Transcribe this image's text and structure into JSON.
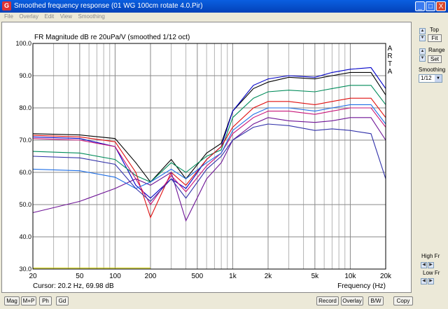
{
  "window": {
    "title": "Smoothed frequency response (01 WG 100cm rotate 4.0.Pir)",
    "icon": "arta-app-icon",
    "minimize": "_",
    "maximize": "□",
    "close": "X"
  },
  "menu": [
    "File",
    "Overlay",
    "Edit",
    "View",
    "Smoothing"
  ],
  "chart_data": {
    "type": "line",
    "title": "FR Magnitude dB re 20uPa/V (smoothed 1/12 oct)",
    "brand": "ARTA",
    "xlabel": "Frequency (Hz)",
    "x_scale": "log",
    "xlim": [
      20,
      20000
    ],
    "ylim": [
      30,
      100
    ],
    "xticks": [
      {
        "v": 20,
        "label": "20"
      },
      {
        "v": 50,
        "label": "50"
      },
      {
        "v": 100,
        "label": "100"
      },
      {
        "v": 200,
        "label": "200"
      },
      {
        "v": 500,
        "label": "500"
      },
      {
        "v": 1000,
        "label": "1k"
      },
      {
        "v": 2000,
        "label": "2k"
      },
      {
        "v": 5000,
        "label": "5k"
      },
      {
        "v": 10000,
        "label": "10k"
      },
      {
        "v": 20000,
        "label": "20k"
      }
    ],
    "yticks": [
      "30.0",
      "40.0",
      "50.0",
      "60.0",
      "70.0",
      "80.0",
      "90.0",
      "100.0"
    ],
    "grid": true,
    "cursor_readout": "Cursor: 20.2 Hz, 69.98 dB",
    "series": [
      {
        "color": "#000000",
        "x": [
          20,
          50,
          100,
          150,
          200,
          300,
          400,
          600,
          800,
          1000,
          1500,
          2000,
          3000,
          5000,
          7000,
          10000,
          15000,
          20000
        ],
        "y": [
          72.0,
          71.6,
          70.5,
          63.0,
          57.0,
          64.0,
          58.0,
          66.0,
          69.0,
          79.0,
          86.0,
          88.0,
          89.5,
          89.0,
          90.0,
          91.0,
          91.0,
          84.0
        ]
      },
      {
        "color": "#0000c8",
        "x": [
          20,
          50,
          100,
          150,
          200,
          300,
          400,
          600,
          800,
          1000,
          1500,
          2000,
          3000,
          5000,
          7000,
          10000,
          15000,
          20000
        ],
        "y": [
          71.0,
          70.5,
          68.0,
          56.0,
          52.0,
          58.0,
          55.0,
          64.0,
          68.0,
          79.0,
          87.0,
          89.0,
          90.0,
          89.5,
          91.0,
          92.0,
          92.5,
          86.0
        ]
      },
      {
        "color": "#008c5a",
        "x": [
          20,
          50,
          100,
          150,
          200,
          300,
          400,
          600,
          800,
          1000,
          1500,
          2000,
          3000,
          5000,
          7000,
          10000,
          15000,
          20000
        ],
        "y": [
          66.5,
          66.0,
          64.0,
          59.0,
          57.0,
          63.0,
          60.0,
          65.0,
          67.0,
          77.0,
          83.0,
          85.0,
          85.5,
          85.0,
          86.0,
          87.0,
          87.0,
          81.0
        ]
      },
      {
        "color": "#e01010",
        "x": [
          20,
          50,
          100,
          150,
          200,
          300,
          400,
          600,
          800,
          1000,
          1500,
          2000,
          3000,
          5000,
          7000,
          10000,
          15000,
          20000
        ],
        "y": [
          71.5,
          71.0,
          69.5,
          60.0,
          46.0,
          60.0,
          56.0,
          64.0,
          68.0,
          74.0,
          80.0,
          82.0,
          82.0,
          81.0,
          82.0,
          83.0,
          83.0,
          77.0
        ]
      },
      {
        "color": "#c81478",
        "x": [
          20,
          50,
          100,
          150,
          200,
          300,
          400,
          600,
          800,
          1000,
          1500,
          2000,
          3000,
          5000,
          7000,
          10000,
          15000,
          20000
        ],
        "y": [
          70.5,
          70.0,
          68.0,
          58.0,
          50.0,
          59.0,
          54.0,
          62.0,
          66.0,
          72.0,
          77.0,
          79.0,
          79.0,
          78.0,
          79.0,
          80.0,
          80.0,
          74.0
        ]
      },
      {
        "color": "#6e1496",
        "x": [
          20,
          50,
          100,
          150,
          200,
          300,
          400,
          600,
          800,
          1000,
          1500,
          2000,
          3000,
          5000,
          7000,
          10000,
          15000,
          20000
        ],
        "y": [
          47.5,
          51.0,
          55.0,
          58.0,
          56.0,
          60.0,
          45.0,
          58.0,
          63.0,
          70.0,
          75.0,
          77.0,
          76.0,
          75.5,
          76.0,
          77.0,
          77.0,
          70.0
        ]
      },
      {
        "color": "#1e6ee6",
        "x": [
          20,
          50,
          100,
          150,
          200,
          300,
          400,
          600,
          800,
          1000,
          1500,
          2000,
          3000,
          5000,
          7000,
          10000,
          15000,
          20000
        ],
        "y": [
          61.0,
          60.5,
          58.5,
          55.0,
          57.0,
          61.0,
          58.0,
          63.0,
          66.0,
          73.0,
          78.0,
          80.0,
          80.0,
          79.0,
          80.0,
          81.0,
          81.0,
          75.0
        ]
      },
      {
        "color": "#3232aa",
        "x": [
          20,
          50,
          100,
          150,
          200,
          300,
          400,
          600,
          800,
          1000,
          1500,
          2000,
          3000,
          5000,
          7000,
          10000,
          15000,
          20000
        ],
        "y": [
          65.0,
          64.5,
          62.5,
          55.0,
          51.0,
          58.0,
          52.0,
          61.0,
          65.0,
          70.0,
          74.0,
          75.0,
          74.5,
          73.0,
          73.5,
          73.0,
          72.0,
          58.0
        ]
      },
      {
        "color": "#c8c800",
        "x": [
          20,
          200
        ],
        "y": [
          30.3,
          30.3
        ]
      }
    ]
  },
  "side": {
    "top_label": "Top",
    "fit_label": "Fit",
    "range_label": "Range",
    "set_label": "Set",
    "smoothing_label": "Smoothing",
    "smoothing_value": "1/12",
    "high_fr_label": "High Fr",
    "low_fr_label": "Low Fr"
  },
  "bottom": {
    "mag": "Mag",
    "mphase": "M+P",
    "phase": "Ph",
    "gd": "Gd",
    "record": "Record",
    "overlay": "Overlay",
    "bw": "B/W",
    "copy": "Copy"
  }
}
